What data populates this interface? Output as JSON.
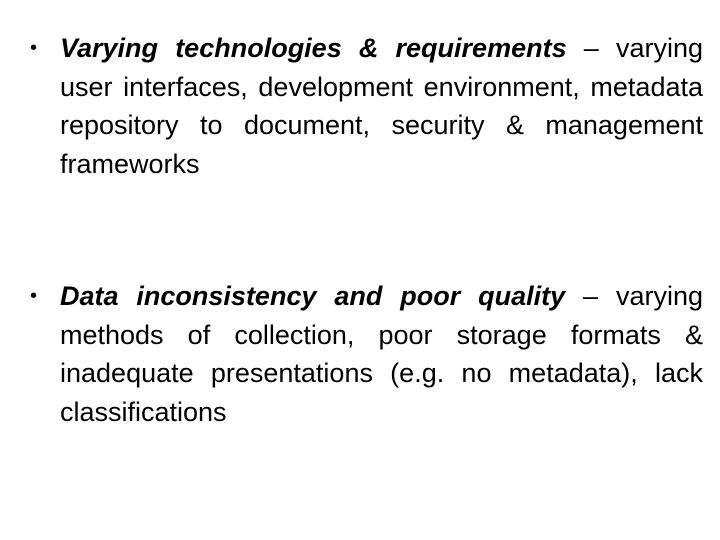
{
  "bullets": [
    {
      "bullet_glyph": "•",
      "heading": "Varying technologies & requirements",
      "separator": " – ",
      "body": "varying user interfaces, development environment, metadata repository to document, security & management frameworks"
    },
    {
      "bullet_glyph": "•",
      "heading": "Data inconsistency and poor quality",
      "separator": " – ",
      "body": "varying methods of collection, poor storage formats & inadequate presentations (e.g. no metadata), lack classifications"
    }
  ]
}
